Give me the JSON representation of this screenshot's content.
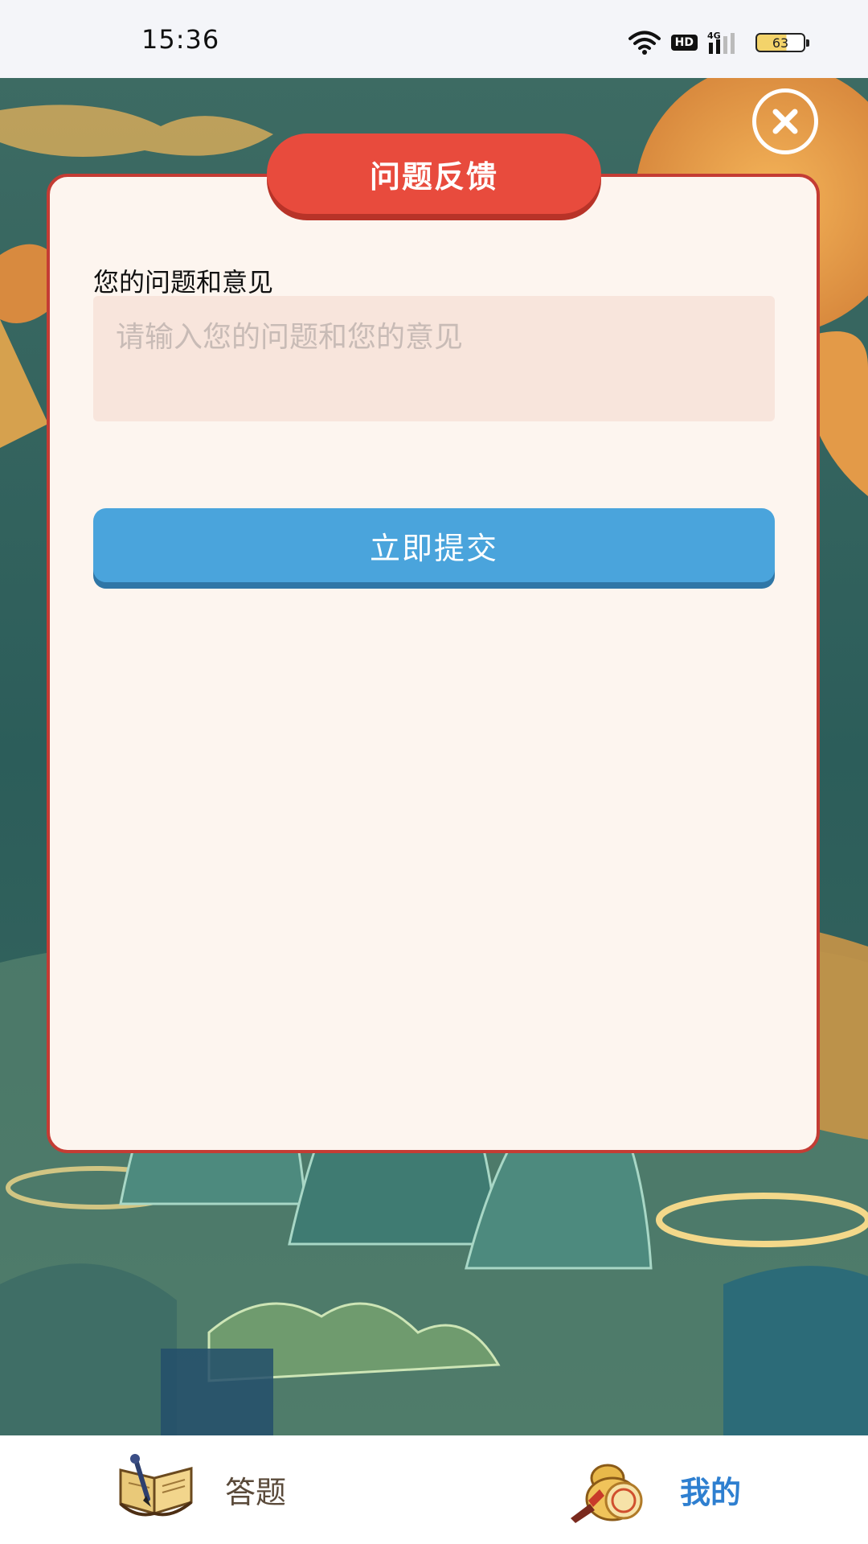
{
  "status_bar": {
    "time": "15:36",
    "network_type": "4G",
    "hd_label": "HD",
    "battery_level": "63",
    "icons": [
      "wifi-icon",
      "hd-icon",
      "signal-icon",
      "battery-icon"
    ]
  },
  "dialog": {
    "title": "问题反馈",
    "field_label": "您的问题和意见",
    "input_placeholder": "请输入您的问题和您的意见",
    "input_value": "",
    "submit_label": "立即提交",
    "close_icon": "close-icon"
  },
  "bottom_nav": {
    "items": [
      {
        "label": "答题",
        "icon": "book-brush-icon",
        "active": false
      },
      {
        "label": "我的",
        "icon": "coin-gourd-icon",
        "active": true
      }
    ]
  },
  "colors": {
    "dialog_bg": "#fdf5ef",
    "dialog_border": "#c43c34",
    "title_tab": "#e84b3d",
    "input_bg": "#f8e5dc",
    "submit_btn": "#4aa4dc",
    "nav_active": "#2e7fd0",
    "nav_inactive": "#5a4a3a"
  }
}
